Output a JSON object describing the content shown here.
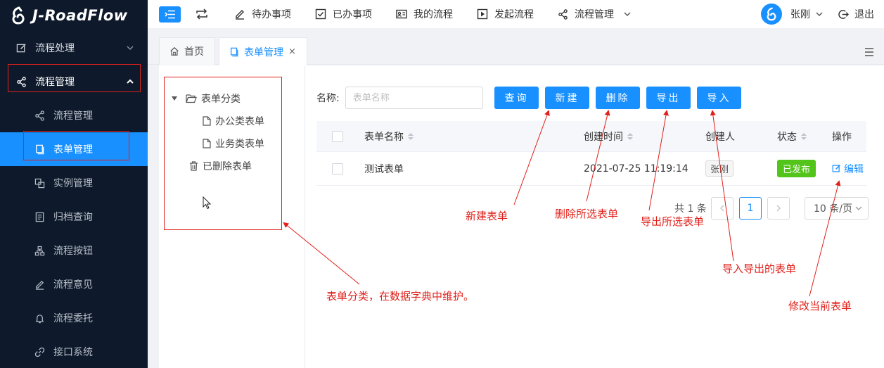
{
  "app": {
    "logo_text": "J-RoadFlow"
  },
  "colors": {
    "primary": "#1890ff",
    "sidebar_bg": "#0e1a2b",
    "success": "#52c41a",
    "annotation": "#e0201a"
  },
  "sidebar": {
    "items": [
      {
        "label": "流程处理",
        "icon": "edit-icon",
        "level": "top",
        "expanded": false
      },
      {
        "label": "流程管理",
        "icon": "share-icon",
        "level": "top",
        "expanded": true
      },
      {
        "label": "流程管理",
        "icon": "share-icon",
        "level": "sub"
      },
      {
        "label": "表单管理",
        "icon": "copy-icon",
        "level": "sub",
        "active": true
      },
      {
        "label": "实例管理",
        "icon": "layers-icon",
        "level": "sub"
      },
      {
        "label": "归档查询",
        "icon": "archive-icon",
        "level": "sub"
      },
      {
        "label": "流程按钮",
        "icon": "hierarchy-icon",
        "level": "sub"
      },
      {
        "label": "流程意见",
        "icon": "pen-icon",
        "level": "sub"
      },
      {
        "label": "流程委托",
        "icon": "bell-icon",
        "level": "sub"
      },
      {
        "label": "接口系统",
        "icon": "link-icon",
        "level": "sub"
      }
    ]
  },
  "header": {
    "nav": [
      {
        "label": "待办事项",
        "icon": "pen-icon"
      },
      {
        "label": "已办事项",
        "icon": "checkbox-icon"
      },
      {
        "label": "我的流程",
        "icon": "card-icon"
      },
      {
        "label": "发起流程",
        "icon": "play-icon"
      },
      {
        "label": "流程管理",
        "icon": "share-icon"
      }
    ],
    "user_name": "张刚",
    "logout_label": "退出"
  },
  "tabs": [
    {
      "label": "首页",
      "icon": "home-icon"
    },
    {
      "label": "表单管理",
      "icon": "copy-icon",
      "active": true,
      "close": "×"
    }
  ],
  "tree": {
    "root": "表单分类",
    "children": [
      "办公类表单",
      "业务类表单"
    ],
    "deleted": "已删除表单"
  },
  "search": {
    "label": "名称:",
    "placeholder": "表单名称"
  },
  "buttons": {
    "query": "查询",
    "create": "新建",
    "delete": "删除",
    "export": "导出",
    "import": "导入"
  },
  "table": {
    "columns": [
      "表单名称",
      "创建时间",
      "创建人",
      "状态",
      "操作"
    ],
    "rows": [
      {
        "name": "测试表单",
        "created": "2021-07-25 11:19:14",
        "creator": "张刚",
        "status": "已发布",
        "action": "编辑"
      }
    ]
  },
  "pager": {
    "total": "共 1 条",
    "current_page": 1,
    "page_size": "10 条/页"
  },
  "annotations": {
    "create": "新建表单",
    "delete": "删除所选表单",
    "export": "导出所选表单",
    "import": "导入导出的表单",
    "edit": "修改当前表单",
    "tree": "表单分类，在数据字典中维护。"
  }
}
